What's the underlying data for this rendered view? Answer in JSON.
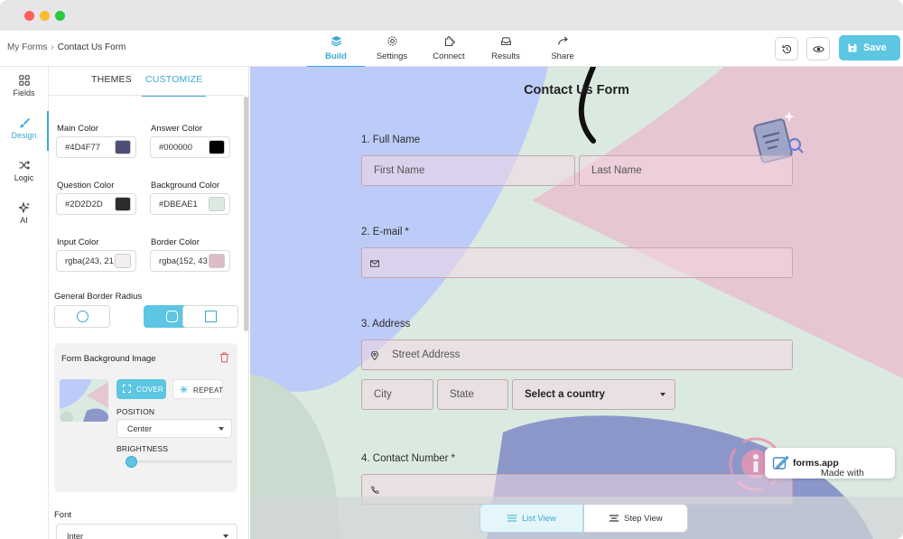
{
  "breadcrumb": {
    "parent": "My Forms",
    "separator": "›",
    "current": "Contact Us Form"
  },
  "top_nav": {
    "build": "Build",
    "settings": "Settings",
    "connect": "Connect",
    "results": "Results",
    "share": "Share"
  },
  "actions": {
    "save": "Save"
  },
  "left_rail": {
    "fields": "Fields",
    "design": "Design",
    "logic": "Logic",
    "ai": "AI"
  },
  "panel": {
    "tabs": {
      "themes": "THEMES",
      "customize": "CUSTOMIZE"
    },
    "colors": {
      "main": {
        "label": "Main Color",
        "value": "#4D4F77",
        "swatch": "#4d4f77"
      },
      "answer": {
        "label": "Answer Color",
        "value": "#000000",
        "swatch": "#000000"
      },
      "question": {
        "label": "Question Color",
        "value": "#2D2D2D",
        "swatch": "#2d2d2d"
      },
      "background": {
        "label": "Background Color",
        "value": "#DBEAE1",
        "swatch": "#dbeae1"
      },
      "input": {
        "label": "Input Color",
        "value": "rgba(243, 21",
        "swatch": "#f3eef0"
      },
      "border": {
        "label": "Border Color",
        "value": "rgba(152, 43",
        "swatch": "#dcbcc8"
      }
    },
    "border_radius": {
      "label": "General Border Radius",
      "selected": "rounded"
    },
    "background_image": {
      "title": "Form Background Image",
      "cover": "COVER",
      "repeat": "REPEAT",
      "position_label": "POSITION",
      "position_value": "Center",
      "brightness_label": "BRIGHTNESS",
      "brightness_level": 0.05
    },
    "font": {
      "label": "Font",
      "value": "Inter"
    }
  },
  "form": {
    "title": "Contact Us Form",
    "q1": {
      "label": "1. Full Name",
      "first": "First Name",
      "last": "Last Name"
    },
    "q2": {
      "label": "2. E-mail",
      "required": "*"
    },
    "q3": {
      "label": "3. Address",
      "street": "Street Address",
      "city": "City",
      "state": "State",
      "country": "Select a country"
    },
    "q4": {
      "label": "4. Contact Number",
      "required": "*"
    }
  },
  "view_toggle": {
    "list": "List View",
    "step": "Step View",
    "active": "list"
  },
  "badge": {
    "prefix": "Made with ",
    "brand": "forms.app"
  },
  "theme_colors": {
    "accent": "#3aa9d1",
    "accent_light": "#5cc6e3",
    "blue_shape": "#bccbf7",
    "pink_shape": "#e6c6d2",
    "green_bg": "#dbeae1"
  }
}
